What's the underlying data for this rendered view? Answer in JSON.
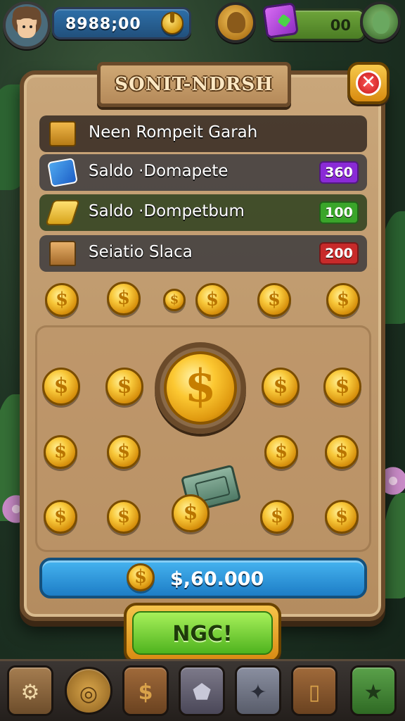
{
  "hud": {
    "currency_value": "8988;00",
    "gem_value": "00"
  },
  "dialog": {
    "title": "SONIT-NDRSH",
    "close_symbol": "✕",
    "rows": [
      {
        "label": "Neen Rompeit Garah",
        "icon": "crate-icon",
        "badge": null
      },
      {
        "label": "Saldo ·Domapete",
        "icon": "card-icon",
        "badge": "360",
        "badge_color": "#8a2ad6"
      },
      {
        "label": "Saldo ·Dompetbum",
        "icon": "gold-bar-icon",
        "badge": "100",
        "badge_color": "#3aa52a"
      },
      {
        "label": "Seiatio Slaca",
        "icon": "chest-icon",
        "badge": "200",
        "badge_color": "#c72a2a"
      }
    ],
    "total": "$,60.000",
    "action_button": "NGC!"
  },
  "nav": {
    "items": [
      {
        "name": "chest-nav",
        "glyph": "⚙"
      },
      {
        "name": "coin-nav",
        "glyph": "◎"
      },
      {
        "name": "dollar-nav",
        "glyph": "$"
      },
      {
        "name": "shield-nav",
        "glyph": "⬟"
      },
      {
        "name": "star-nav",
        "glyph": "✦"
      },
      {
        "name": "door-nav",
        "glyph": "▯"
      },
      {
        "name": "star-badge-nav",
        "glyph": "★"
      }
    ]
  },
  "colors": {
    "panel": "#c9a67a",
    "accent_blue": "#1d7dc6",
    "accent_green": "#4fb31e",
    "gold": "#f8c83a"
  }
}
